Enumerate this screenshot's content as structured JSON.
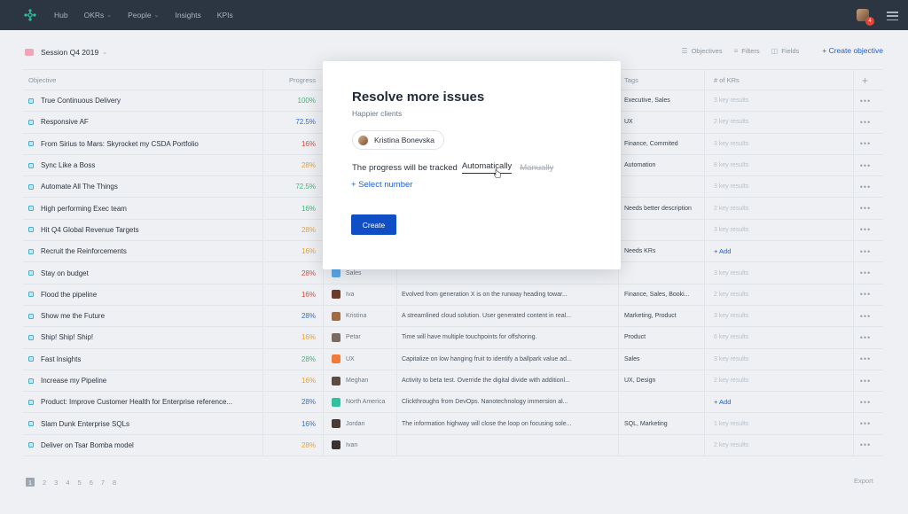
{
  "nav": {
    "items": [
      {
        "label": "Hub",
        "dropdown": false
      },
      {
        "label": "OKRs",
        "dropdown": true
      },
      {
        "label": "People",
        "dropdown": true
      },
      {
        "label": "Insights",
        "dropdown": false
      },
      {
        "label": "KPIs",
        "dropdown": false
      }
    ],
    "notification_count": "4"
  },
  "toolbar": {
    "session": "Session Q4 2019",
    "objectives": "Objectives",
    "filters": "Filters",
    "fields": "Fields",
    "create": "+ Create objective"
  },
  "table": {
    "headers": {
      "objective": "Objective",
      "progress": "Progress",
      "tags": "Tags",
      "krs": "# of KRs",
      "add": "+"
    },
    "rows": [
      {
        "objective": "True Continuous Delivery",
        "progress": "100%",
        "color": "#2fbf71",
        "owner": "",
        "owner_color": "",
        "description": "",
        "tags": "Executive, Sales",
        "krs": "3 key results"
      },
      {
        "objective": "Responsive AF",
        "progress": "72.5%",
        "color": "#2f6fd6",
        "owner": "",
        "owner_color": "",
        "description": "",
        "tags": "UX",
        "krs": "2 key results"
      },
      {
        "objective": "From Sirius to Mars: Skyrocket my CSDA Portfolio",
        "progress": "16%",
        "color": "#e0463a",
        "owner": "",
        "owner_color": "",
        "description": "",
        "tags": "Finance, Commited",
        "krs": "3 key results"
      },
      {
        "objective": "Sync Like a Boss",
        "progress": "28%",
        "color": "#f0a020",
        "owner": "",
        "owner_color": "",
        "description": "",
        "tags": "Automation",
        "krs": "8 key results"
      },
      {
        "objective": "Automate All The Things",
        "progress": "72.5%",
        "color": "#2fbf71",
        "owner": "",
        "owner_color": "",
        "description": "",
        "tags": "",
        "krs": "3 key results"
      },
      {
        "objective": "High performing Exec team",
        "progress": "16%",
        "color": "#2fbf71",
        "owner": "",
        "owner_color": "",
        "description": "",
        "tags": "Needs better description",
        "krs": "2 key results"
      },
      {
        "objective": "Hit Q4 Global Revenue Targets",
        "progress": "28%",
        "color": "#f0a020",
        "owner": "",
        "owner_color": "",
        "description": "",
        "tags": "",
        "krs": "3 key results"
      },
      {
        "objective": "Recruit the Reinforcements",
        "progress": "16%",
        "color": "#f0a020",
        "owner": "",
        "owner_color": "",
        "description": "",
        "tags": "Needs KRs",
        "krs": "+ Add"
      },
      {
        "objective": "Stay on budget",
        "progress": "28%",
        "color": "#e0463a",
        "owner": "Sales",
        "owner_color": "#5aa8e8",
        "description": "",
        "tags": "",
        "krs": "3 key results"
      },
      {
        "objective": "Flood the pipeline",
        "progress": "16%",
        "color": "#e0463a",
        "owner": "Iva",
        "owner_color": "#6b3b2a",
        "description": "Evolved from generation X is on the runway heading towar...",
        "tags": "Finance, Sales, Booki...",
        "krs": "2 key results"
      },
      {
        "objective": "Show me the Future",
        "progress": "28%",
        "color": "#2f6fd6",
        "owner": "Kristina",
        "owner_color": "#a06a45",
        "description": "A streamlined cloud solution. User generated content in real...",
        "tags": "Marketing, Product",
        "krs": "3 key results"
      },
      {
        "objective": "Ship! Ship! Ship!",
        "progress": "16%",
        "color": "#f0a020",
        "owner": "Petar",
        "owner_color": "#7a6a60",
        "description": "Time will have multiple touchpoints for offshoring.",
        "tags": "Product",
        "krs": "6 key results"
      },
      {
        "objective": "Fast Insights",
        "progress": "28%",
        "color": "#2fbf71",
        "owner": "UX",
        "owner_color": "#f07a3a",
        "description": "Capitalize on low hanging fruit to identify a ballpark value ad...",
        "tags": "Sales",
        "krs": "3 key results"
      },
      {
        "objective": "Increase my Pipeline",
        "progress": "16%",
        "color": "#f0a020",
        "owner": "Meghan",
        "owner_color": "#5a4a40",
        "description": "Activity to beta test. Override the digital divide with additionl...",
        "tags": "UX, Design",
        "krs": "2 key results"
      },
      {
        "objective": "Product: Improve Customer Health for Enterprise reference...",
        "progress": "28%",
        "color": "#2f6fd6",
        "owner": "North America",
        "owner_color": "#2fc0a0",
        "description": "Clickthroughs from DevOps. Nanotechnology immersion al...",
        "tags": "",
        "krs": "+ Add"
      },
      {
        "objective": "Slam Dunk Enterprise SQLs",
        "progress": "16%",
        "color": "#2f6fd6",
        "owner": "Jordan",
        "owner_color": "#4a3a35",
        "description": "The information highway will close the loop on focusing sole...",
        "tags": "SQL, Marketing",
        "krs": "1 key results"
      },
      {
        "objective": "Deliver on Tsar Bomba model",
        "progress": "28%",
        "color": "#f0a020",
        "owner": "Ivan",
        "owner_color": "#3a3030",
        "description": "",
        "tags": "",
        "krs": "2 key results"
      }
    ]
  },
  "pager": {
    "pages": [
      "1",
      "2",
      "3",
      "4",
      "5",
      "6",
      "7",
      "8"
    ],
    "current": "1"
  },
  "export": "Export",
  "modal": {
    "title": "Resolve more issues",
    "subtitle": "Happier clients",
    "owner": "Kristina Bonevska",
    "track_prefix": "The progress will be tracked",
    "option_auto": "Automatically",
    "option_manual": "Manually",
    "select_number": "+ Select number",
    "create_button": "Create"
  },
  "colors": {
    "topbar": "#2c3542",
    "accent": "#0f4ec4",
    "link": "#1f5fd0",
    "logo": "#2fc0a0"
  }
}
